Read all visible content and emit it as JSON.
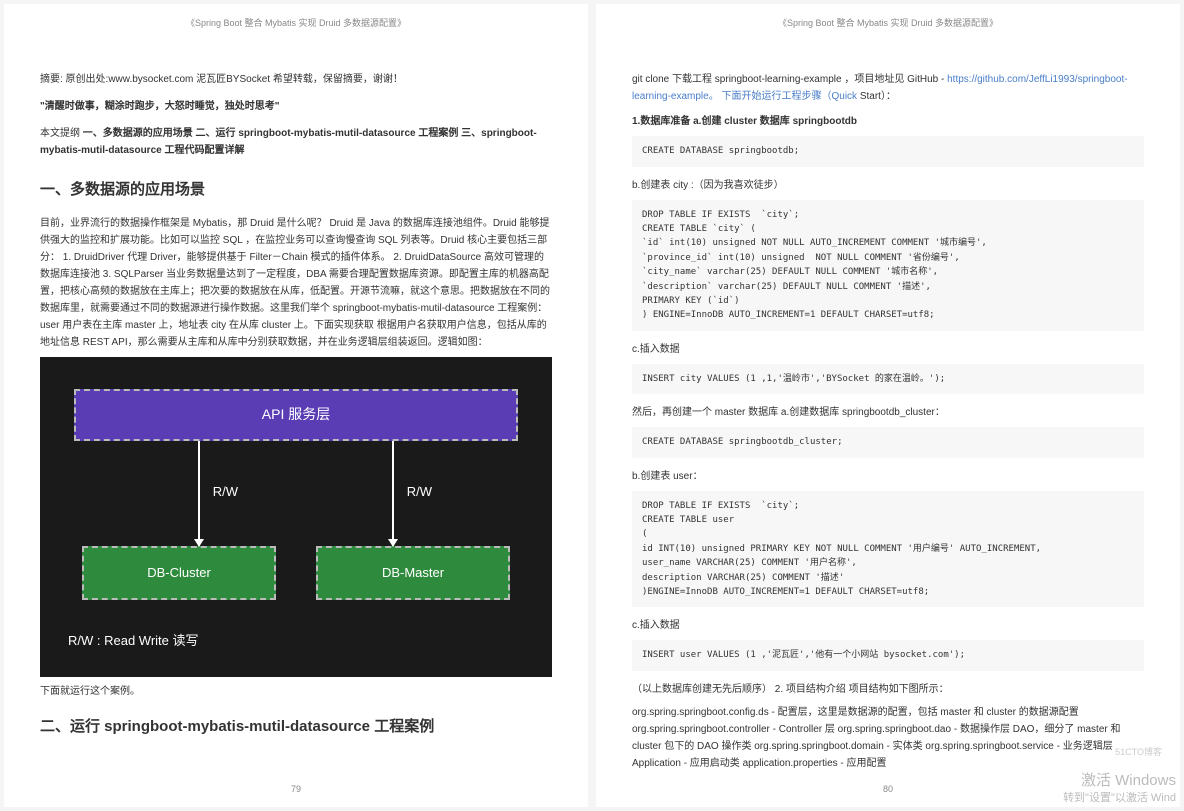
{
  "doc_title": "《Spring Boot 整合 Mybatis 实现 Druid 多数据源配置》",
  "page_left": {
    "abstract": "摘要: 原创出处:www.bysocket.com 泥瓦匠BYSocket 希望转载，保留摘要，谢谢！",
    "quote": "\"清醒时做事，糊涂时跑步，大怒时睡觉，独处时思考\"",
    "outline_prefix": "本文提纲 ",
    "outline_bold": "一、多数据源的应用场景 二、运行 springboot-mybatis-mutil-datasource 工程案例 三、springboot-mybatis-mutil-datasource 工程代码配置详解",
    "section1_title": "一、多数据源的应用场景",
    "section1_body": "目前，业界流行的数据操作框架是 Mybatis，那 Druid 是什么呢？ Druid 是 Java 的数据库连接池组件。Druid 能够提供强大的监控和扩展功能。比如可以监控 SQL ，在监控业务可以查询慢查询 SQL 列表等。Druid 核心主要包括三部分： 1. DruidDriver 代理 Driver，能够提供基于 Filter－Chain 模式的插件体系。 2. DruidDataSource 高效可管理的数据库连接池 3. SQLParser 当业务数据量达到了一定程度，DBA 需要合理配置数据库资源。即配置主库的机器高配置，把核心高频的数据放在主库上；把次要的数据放在从库，低配置。开源节流嘛，就这个意思。把数据放在不同的数据库里，就需要通过不同的数据源进行操作数据。这里我们举个 springboot-mybatis-mutil-datasource 工程案例： user 用户表在主库 master 上，地址表 city 在从库 cluster 上。下面实现获取 根据用户名获取用户信息，包括从库的地址信息 REST API，那么需要从主库和从库中分别获取数据，并在业务逻辑层组装返回。逻辑如图：",
    "diagram": {
      "api_label": "API 服务层",
      "rw": "R/W",
      "db_cluster": "DB-Cluster",
      "db_master": "DB-Master",
      "legend": "R/W : Read Write 读写"
    },
    "caption": "下面就运行这个案例。",
    "section2_title": "二、运行 springboot-mybatis-mutil-datasource 工程案例",
    "page_num": "79"
  },
  "page_right": {
    "line1_a": "git clone 下载工程 springboot-learning-example ，项目地址见 GitHub - ",
    "line1_link": "https://github.com/JeffLi1993/springboot-learning-example",
    "line1_b": "。 下面开始运行工程步骤（Quick ",
    "line1_c": "Start）：",
    "step1": "1.数据库准备 a.创建 cluster 数据库 springbootdb",
    "code1": "CREATE DATABASE springbootdb;",
    "step_b": "b.创建表 city :（因为我喜欢徒步）",
    "code2": "DROP TABLE IF EXISTS  `city`;\nCREATE TABLE `city` (\n`id` int(10) unsigned NOT NULL AUTO_INCREMENT COMMENT '城市编号',\n`province_id` int(10) unsigned  NOT NULL COMMENT '省份编号',\n`city_name` varchar(25) DEFAULT NULL COMMENT '城市名称',\n`description` varchar(25) DEFAULT NULL COMMENT '描述',\nPRIMARY KEY (`id`)\n) ENGINE=InnoDB AUTO_INCREMENT=1 DEFAULT CHARSET=utf8;",
    "step_c": "c.插入数据",
    "code3": "INSERT city VALUES (1 ,1,'温岭市','BYSocket 的家在温岭。');",
    "then": "然后，再创建一个 master 数据库 a.创建数据库 springbootdb_cluster：",
    "code4": "CREATE DATABASE springbootdb_cluster;",
    "step_b2": "b.创建表 user：",
    "code5": "DROP TABLE IF EXISTS  `city`;\nCREATE TABLE user\n(\nid INT(10) unsigned PRIMARY KEY NOT NULL COMMENT '用户编号' AUTO_INCREMENT,\nuser_name VARCHAR(25) COMMENT '用户名称',\ndescription VARCHAR(25) COMMENT '描述'\n)ENGINE=InnoDB AUTO_INCREMENT=1 DEFAULT CHARSET=utf8;",
    "step_c2": "c.插入数据",
    "code6": "INSERT user VALUES (1 ,'泥瓦匠','他有一个小网站 bysocket.com');",
    "proj_intro": "（以上数据库创建无先后顺序） 2. 项目结构介绍 项目结构如下图所示：",
    "proj_lines": "org.spring.springboot.config.ds - 配置层，这里是数据源的配置，包括 master 和 cluster 的数据源配置 org.spring.springboot.controller - Controller 层 org.spring.springboot.dao - 数据操作层 DAO，细分了 master 和 cluster 包下的 DAO 操作类 org.spring.springboot.domain - 实体类 org.spring.springboot.service - 业务逻辑层 Application - 应用启动类 application.properties - 应用配置",
    "page_num": "80",
    "cto": "51CTO博客"
  },
  "watermark": {
    "line1": "激活 Windows",
    "line2": "转到\"设置\"以激活 Wind"
  }
}
